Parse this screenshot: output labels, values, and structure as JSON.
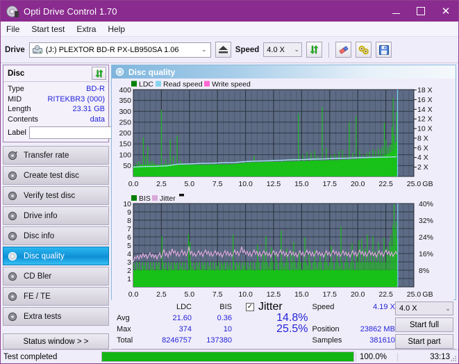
{
  "window": {
    "title": "Opti Drive Control 1.70",
    "icon": "disc-icon",
    "minimize": "–",
    "maximize": "□",
    "close": "✕"
  },
  "menu": {
    "items": [
      "File",
      "Start test",
      "Extra",
      "Help"
    ]
  },
  "toolbar": {
    "drive_label": "Drive",
    "drive_value": "(J:)  PLEXTOR BD-R  PX-LB950SA 1.06",
    "eject_icon": "eject-icon",
    "speed_label": "Speed",
    "speed_value": "4.0 X",
    "refresh_icon": "refresh-icon",
    "erase_icon": "eraser-icon",
    "tools_icon": "tools-icon",
    "save_icon": "save-icon"
  },
  "sidebar": {
    "disc": {
      "title": "Disc",
      "refresh_icon": "refresh-icon",
      "rows": [
        {
          "key": "Type",
          "value": "BD-R"
        },
        {
          "key": "MID",
          "value": "RITEKBR3 (000)"
        },
        {
          "key": "Length",
          "value": "23.31 GB"
        },
        {
          "key": "Contents",
          "value": "data"
        }
      ],
      "label_key": "Label",
      "label_value": "",
      "label_icon": "disc-small-icon"
    },
    "nav": [
      {
        "label": "Transfer rate",
        "active": false
      },
      {
        "label": "Create test disc",
        "active": false
      },
      {
        "label": "Verify test disc",
        "active": false
      },
      {
        "label": "Drive info",
        "active": false
      },
      {
        "label": "Disc info",
        "active": false
      },
      {
        "label": "Disc quality",
        "active": true
      },
      {
        "label": "CD Bler",
        "active": false
      },
      {
        "label": "FE / TE",
        "active": false
      },
      {
        "label": "Extra tests",
        "active": false
      }
    ],
    "status_window": "Status window > >"
  },
  "panel": {
    "title": "Disc quality",
    "icon": "disc-quality-icon"
  },
  "stats": {
    "col_ldc": "LDC",
    "col_bis": "BIS",
    "rows": [
      {
        "label": "Avg",
        "ldc": "21.60",
        "bis": "0.36"
      },
      {
        "label": "Max",
        "ldc": "374",
        "bis": "10"
      },
      {
        "label": "Total",
        "ldc": "8246757",
        "bis": "137380"
      }
    ],
    "jitter_label": "Jitter",
    "jitter_checked": true,
    "jitter_check_glyph": "✓",
    "jitter_avg": "14.8%",
    "jitter_max": "25.5%",
    "speed_label": "Speed",
    "speed_value": "4.19 X",
    "position_label": "Position",
    "position_value": "23862 MB",
    "samples_label": "Samples",
    "samples_value": "381610",
    "speed_select": "4.0 X",
    "start_full": "Start full",
    "start_part": "Start part"
  },
  "statusbar": {
    "message": "Test completed",
    "progress_pct": 100.0,
    "progress_text": "100.0%",
    "elapsed": "33:13"
  },
  "colors": {
    "accent_title": "#8a2b8f",
    "plot_bg": "#5d6b85",
    "grid": "#2f3844",
    "ldc_green": "#19c119",
    "read_speed": "#86d3f0",
    "write_speed": "#ff66d0",
    "jitter_pink": "#d9a8d9",
    "value_blue": "#2323d8",
    "progress_green": "#12b512"
  },
  "chart_data": [
    {
      "type": "line",
      "name": "top-chart-ldc",
      "title": "",
      "legend": [
        {
          "label": "LDC",
          "color": "#008000"
        },
        {
          "label": "Read speed",
          "color": "#86d3f0"
        },
        {
          "label": "Write speed",
          "color": "#ff66d0"
        }
      ],
      "xlabel": "GB",
      "xlim": [
        0.0,
        25.0
      ],
      "xticks": [
        0.0,
        2.5,
        5.0,
        7.5,
        10.0,
        12.5,
        15.0,
        17.5,
        20.0,
        22.5,
        25.0
      ],
      "xticklabels": [
        "0.0",
        "2.5",
        "5.0",
        "7.5",
        "10.0",
        "12.5",
        "15.0",
        "17.5",
        "20.0",
        "22.5",
        "25.0"
      ],
      "ylabel_left": "LDC",
      "ylim_left": [
        0,
        400
      ],
      "yticks_left": [
        50,
        100,
        150,
        200,
        250,
        300,
        350,
        400
      ],
      "yticklabels_left": [
        "50",
        "100",
        "150",
        "200",
        "250",
        "300",
        "350",
        "400"
      ],
      "ylabel_right": "Speed",
      "ylim_right": [
        0,
        18
      ],
      "yticks_right": [
        2,
        4,
        6,
        8,
        10,
        12,
        14,
        16,
        18
      ],
      "yticklabels_right": [
        "2 X",
        "4 X",
        "6 X",
        "8 X",
        "10 X",
        "12 X",
        "14 X",
        "16 X",
        "18 X"
      ],
      "grid": true,
      "data_end_gb": 23.5,
      "series": [
        {
          "name": "LDC",
          "color": "#19c119",
          "kind": "spike-fill",
          "x_gb": [
            0.0,
            0.2,
            0.4,
            0.6,
            0.8,
            1.0,
            1.1,
            1.3,
            1.5,
            1.7,
            1.9,
            2.1,
            2.3,
            2.5,
            2.7,
            2.9,
            3.1,
            3.3,
            3.5,
            3.7,
            3.9,
            4.2,
            4.5,
            4.8,
            5.1,
            5.4,
            5.7,
            6.0,
            6.3,
            6.6,
            6.9,
            7.2,
            7.5,
            7.8,
            8.1,
            8.4,
            8.7,
            9.0,
            9.3,
            9.6,
            9.9,
            10.2,
            10.5,
            10.8,
            11.1,
            11.4,
            11.7,
            12.0,
            12.3,
            12.6,
            12.9,
            13.2,
            13.5,
            13.8,
            14.1,
            14.4,
            14.7,
            15.0,
            15.3,
            15.6,
            15.9,
            16.2,
            16.5,
            16.8,
            17.1,
            17.4,
            17.7,
            18.0,
            18.3,
            18.6,
            18.9,
            19.2,
            19.5,
            19.8,
            20.1,
            20.4,
            20.7,
            21.0,
            21.3,
            21.6,
            21.9,
            22.2,
            22.5,
            22.7,
            22.9,
            23.1,
            23.3,
            23.5
          ],
          "baseline": [
            42,
            44,
            46,
            48,
            50,
            50,
            50,
            50,
            50,
            50,
            50,
            50,
            50,
            50,
            50,
            52,
            52,
            52,
            52,
            52,
            50,
            50,
            50,
            50,
            50,
            50,
            50,
            50,
            50,
            50,
            52,
            52,
            52,
            52,
            52,
            52,
            54,
            54,
            56,
            58,
            60,
            60,
            62,
            62,
            62,
            62,
            64,
            64,
            64,
            64,
            64,
            64,
            66,
            66,
            66,
            66,
            68,
            68,
            68,
            68,
            70,
            70,
            70,
            70,
            70,
            72,
            72,
            72,
            72,
            74,
            74,
            74,
            76,
            76,
            78,
            78,
            80,
            80,
            82,
            84,
            86,
            90,
            96,
            100,
            105,
            110,
            118,
            130
          ],
          "peaks": [
            55,
            62,
            70,
            58,
            180,
            95,
            140,
            68,
            72,
            60,
            306,
            80,
            170,
            95,
            188,
            70,
            60,
            58,
            62,
            60,
            58,
            62,
            58,
            60,
            62,
            58,
            60,
            62,
            60,
            65,
            62,
            60,
            62,
            58,
            60,
            62,
            64,
            70,
            95,
            72,
            68,
            70,
            74,
            76,
            72,
            70,
            74,
            72,
            76,
            78,
            80,
            290,
            100,
            115,
            110,
            120,
            95,
            318,
            130,
            100,
            105,
            115,
            120,
            95,
            250,
            110,
            278,
            120,
            100,
            110,
            115,
            120,
            125,
            118,
            130,
            122,
            135,
            250,
            170,
            135,
            145,
            228,
            365,
            190,
            150,
            160,
            300,
            140
          ]
        },
        {
          "name": "Read speed",
          "color": "#86d3f0",
          "kind": "line-right-axis",
          "x_gb": [
            0.0,
            1.0,
            2.0,
            3.0,
            4.0,
            5.0,
            6.0,
            7.0,
            8.0,
            9.0,
            10.0,
            11.0,
            12.0,
            13.0,
            14.0,
            15.0,
            16.0,
            17.0,
            18.0,
            19.0,
            20.0,
            21.0,
            22.0,
            23.0,
            23.4
          ],
          "values_x": [
            1.95,
            2.05,
            2.1,
            2.2,
            2.55,
            2.6,
            2.7,
            2.75,
            2.85,
            2.9,
            3.1,
            3.2,
            3.25,
            3.35,
            3.45,
            3.5,
            3.6,
            3.65,
            3.75,
            3.8,
            3.9,
            3.95,
            4.0,
            4.05,
            4.1
          ]
        },
        {
          "name": "Write speed",
          "color": "#ff66d0",
          "kind": "none",
          "values_x": []
        }
      ],
      "cursor_gb": 23.5
    },
    {
      "type": "line",
      "name": "bottom-chart-bis",
      "title": "",
      "legend": [
        {
          "label": "BIS",
          "color": "#008000"
        },
        {
          "label": "Jitter",
          "color": "#d9a8d9"
        }
      ],
      "xlabel": "GB",
      "xlim": [
        0.0,
        25.0
      ],
      "xticks": [
        0.0,
        2.5,
        5.0,
        7.5,
        10.0,
        12.5,
        15.0,
        17.5,
        20.0,
        22.5,
        25.0
      ],
      "xticklabels": [
        "0.0",
        "2.5",
        "5.0",
        "7.5",
        "10.0",
        "12.5",
        "15.0",
        "17.5",
        "20.0",
        "22.5",
        "25.0"
      ],
      "ylabel_left": "BIS",
      "ylim_left": [
        0,
        10
      ],
      "yticks_left": [
        1,
        2,
        3,
        4,
        5,
        6,
        7,
        8,
        9,
        10
      ],
      "yticklabels_left": [
        "1",
        "2",
        "3",
        "4",
        "5",
        "6",
        "7",
        "8",
        "9",
        "10"
      ],
      "ylabel_right": "Jitter",
      "ylim_right": [
        0,
        40
      ],
      "yticks_right": [
        8,
        16,
        24,
        32,
        40
      ],
      "yticklabels_right": [
        "8%",
        "16%",
        "24%",
        "32%",
        "40%"
      ],
      "grid": true,
      "data_end_gb": 23.5,
      "series": [
        {
          "name": "BIS",
          "color": "#19c119",
          "kind": "spike-fill",
          "baseline_level": 2.0,
          "typical_peak": 3.0,
          "max_peak": 10,
          "occasional_peaks_gb": [
            2.6,
            4.95,
            5.05,
            9.15,
            11.6,
            12.15,
            13.9,
            15.1,
            16.2,
            16.7,
            18.4,
            19.4,
            19.8,
            20.4,
            20.9,
            21.3,
            22.4,
            22.9,
            23.1
          ],
          "occasional_peak_values": [
            6.1,
            6.3,
            5.4,
            6.35,
            5.0,
            6.1,
            6.8,
            8.0,
            6.3,
            6.3,
            8.1,
            6.6,
            7.2,
            6.8,
            7.3,
            6.7,
            7.0,
            10.0,
            8.5
          ]
        },
        {
          "name": "Jitter",
          "color": "#d9a8d9",
          "kind": "line-right-axis",
          "avg_pct": 14.8,
          "max_pct": 25.5,
          "band_pct": [
            13.0,
            17.5
          ]
        }
      ],
      "cursor_gb": 23.5
    }
  ]
}
